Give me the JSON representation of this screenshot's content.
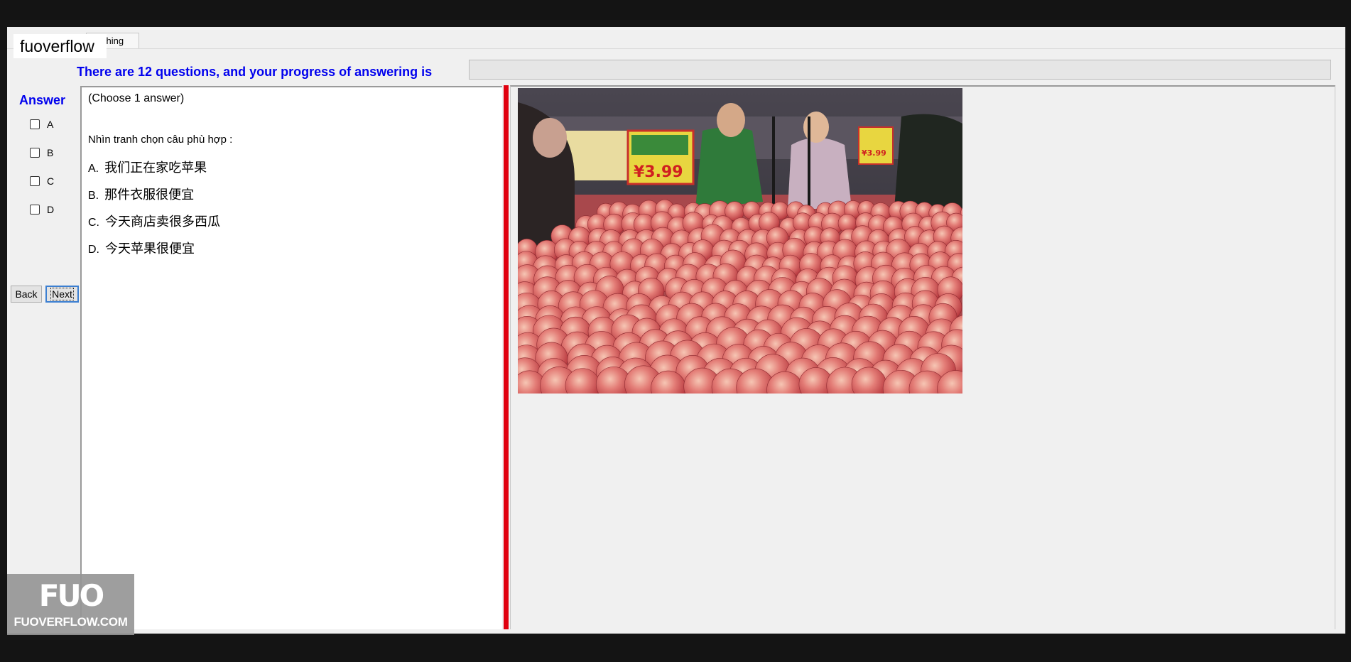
{
  "app": {
    "brand": "fuoverflow",
    "tab_label": "ching"
  },
  "progress": {
    "label": "There are 12 questions, and your progress of answering is",
    "value_percent": 0
  },
  "answer_panel": {
    "title": "Answer",
    "options": [
      "A",
      "B",
      "C",
      "D"
    ]
  },
  "nav": {
    "back_label": "Back",
    "next_label": "Next"
  },
  "question": {
    "instruction": "(Choose 1 answer)",
    "prompt": "Nhìn tranh chọn câu phù hợp :",
    "choices": [
      {
        "letter": "A.",
        "text": "我们正在家吃苹果"
      },
      {
        "letter": "B.",
        "text": "那件衣服很便宜"
      },
      {
        "letter": "C.",
        "text": "今天商店卖很多西瓜"
      },
      {
        "letter": "D.",
        "text": "今天苹果很便宜"
      }
    ]
  },
  "photo": {
    "price_sign_main": "¥3.99",
    "price_sign_right": "¥3.99"
  },
  "watermark": {
    "logo": "FUO",
    "site": "FUOVERFLOW.COM"
  },
  "colors": {
    "accent_blue": "#0000ee",
    "splitter_red": "#e0000f"
  }
}
